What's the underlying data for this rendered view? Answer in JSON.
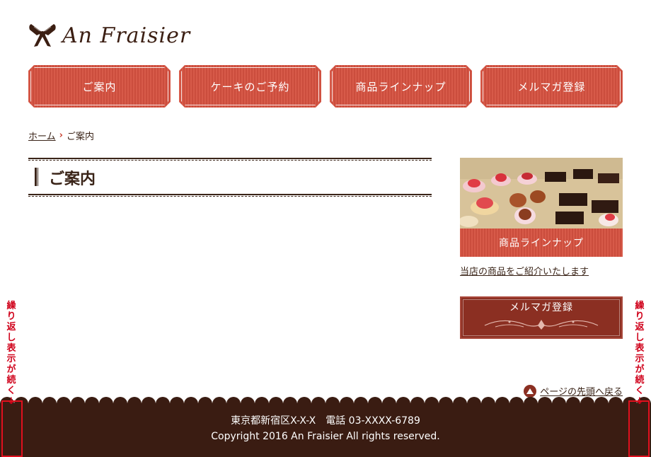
{
  "header": {
    "logo_text": "An Fraisier",
    "logo_icon": "ribbon-bow-icon"
  },
  "nav": {
    "items": [
      {
        "label": "ご案内"
      },
      {
        "label": "ケーキのご予約"
      },
      {
        "label": "商品ラインナップ"
      },
      {
        "label": "メルマガ登録"
      }
    ]
  },
  "breadcrumb": {
    "home": "ホーム",
    "current": "ご案内"
  },
  "main": {
    "title": "ご案内"
  },
  "sidebar": {
    "banner_caption": "商品ラインナップ",
    "banner_link": "当店の商品をご紹介いたします",
    "mail_button": "メルマガ登録"
  },
  "page_top": {
    "label": "ページの先頭へ戻る"
  },
  "footer": {
    "address": "東京都新宿区X-X-X　電話 03-XXXX-6789",
    "copyright": "Copyright 2016 An Fraisier All rights reserved."
  },
  "annotation": {
    "repeat_note": "繰り返し表示が続く↓"
  },
  "colors": {
    "accent": "#d25545",
    "dark_brown": "#3a1c12",
    "wine": "#8b2f22",
    "annotation_red": "#e0101e"
  }
}
